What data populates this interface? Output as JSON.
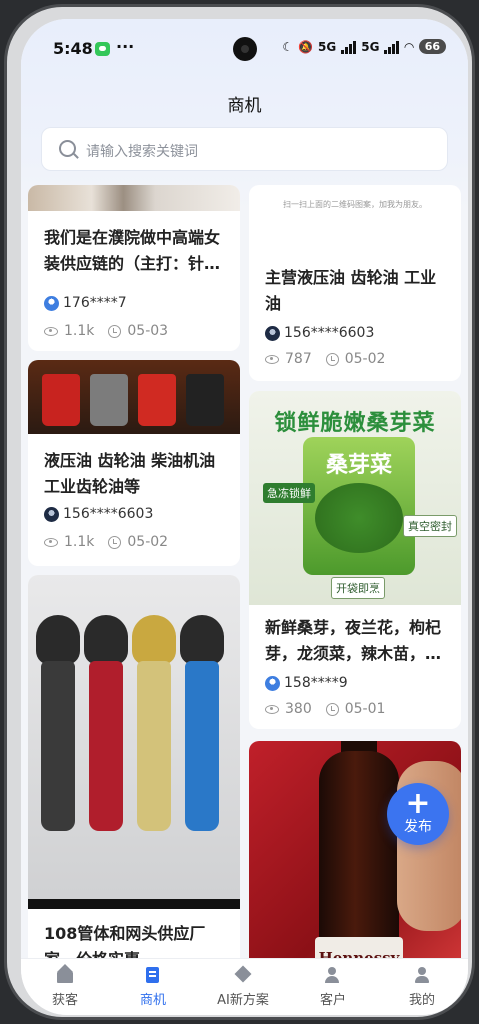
{
  "status": {
    "time": "5:48",
    "more": "···",
    "net1": "5G",
    "net2": "5G",
    "battery": "66"
  },
  "header": {
    "title": "商机"
  },
  "search": {
    "placeholder": "请输入搜索关键词"
  },
  "feed": {
    "left": [
      {
        "title": "我们是在濮院做中高端女装供应链的（主打：针…",
        "user": "176****7",
        "views": "1.1k",
        "date": "05-03"
      },
      {
        "title": "液压油 齿轮油 柴油机油 工业齿轮油等",
        "user": "156****6603",
        "views": "1.1k",
        "date": "05-02"
      },
      {
        "title": "108管体和网头供应厂家，价格实惠"
      }
    ],
    "right": [
      {
        "hint": "扫一扫上面的二维码图案，加我为朋友。",
        "title": "主营液压油 齿轮油 工业油",
        "user": "156****6603",
        "views": "787",
        "date": "05-02"
      },
      {
        "image_title": "锁鲜脆嫩桑芽菜",
        "bag_label": "桑芽菜",
        "tag1": "急冻锁鲜",
        "tag2": "真空密封",
        "tag3": "开袋即烹",
        "title": "新鲜桑芽，夜兰花，枸杞芽，龙须菜，辣木苗，…",
        "user": "158****9",
        "views": "380",
        "date": "05-01"
      },
      {
        "brand": "Hennessy"
      }
    ]
  },
  "fab": {
    "plus": "+",
    "label": "发布"
  },
  "tabs": [
    {
      "label": "获客",
      "icon": "home-icon"
    },
    {
      "label": "商机",
      "icon": "document-icon",
      "active": true
    },
    {
      "label": "AI新方案",
      "icon": "diamond-icon"
    },
    {
      "label": "客户",
      "icon": "users-icon"
    },
    {
      "label": "我的",
      "icon": "profile-icon"
    }
  ],
  "colors": {
    "accent": "#2f6fed",
    "fab": "#3b74f0",
    "background": "#f3f5f9"
  }
}
